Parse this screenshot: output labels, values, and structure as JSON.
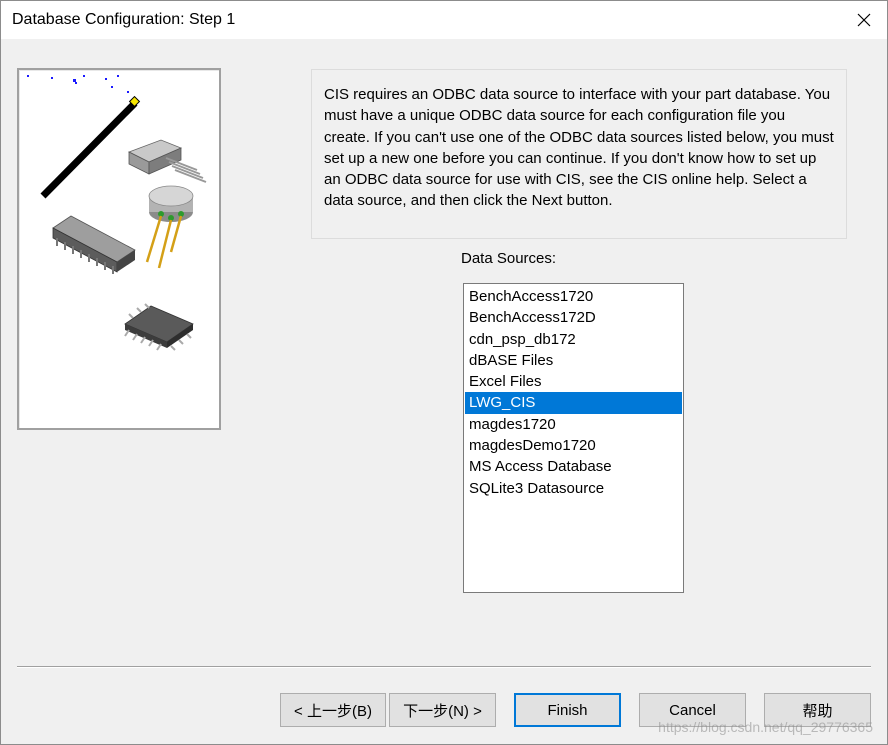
{
  "window": {
    "title": "Database Configuration: Step 1"
  },
  "info": {
    "text": "CIS requires an ODBC data source to interface with your part database. You must have a unique ODBC data source for each configuration file you create. If you can't use one of the ODBC data sources listed below, you must set up a new one before you can continue. If you don't know how to set up an ODBC data source for use with CIS, see the CIS online help.  Select a data source, and then click the Next button."
  },
  "data_sources": {
    "label": "Data Sources:",
    "items": [
      "BenchAccess1720",
      "BenchAccess172D",
      "cdn_psp_db172",
      "dBASE Files",
      "Excel Files",
      "LWG_CIS",
      "magdes1720",
      "magdesDemo1720",
      "MS Access Database",
      "SQLite3 Datasource"
    ],
    "selected": "LWG_CIS"
  },
  "buttons": {
    "back": "< 上一步(B)",
    "next": "下一步(N) >",
    "finish": "Finish",
    "cancel": "Cancel",
    "help": "帮助"
  },
  "watermark": "https://blog.csdn.net/qq_29776365",
  "icons": {
    "close": "close-icon",
    "illustration": "wizard-illustration"
  },
  "colors": {
    "selection": "#0078d7",
    "default_button_border": "#0078d7"
  }
}
